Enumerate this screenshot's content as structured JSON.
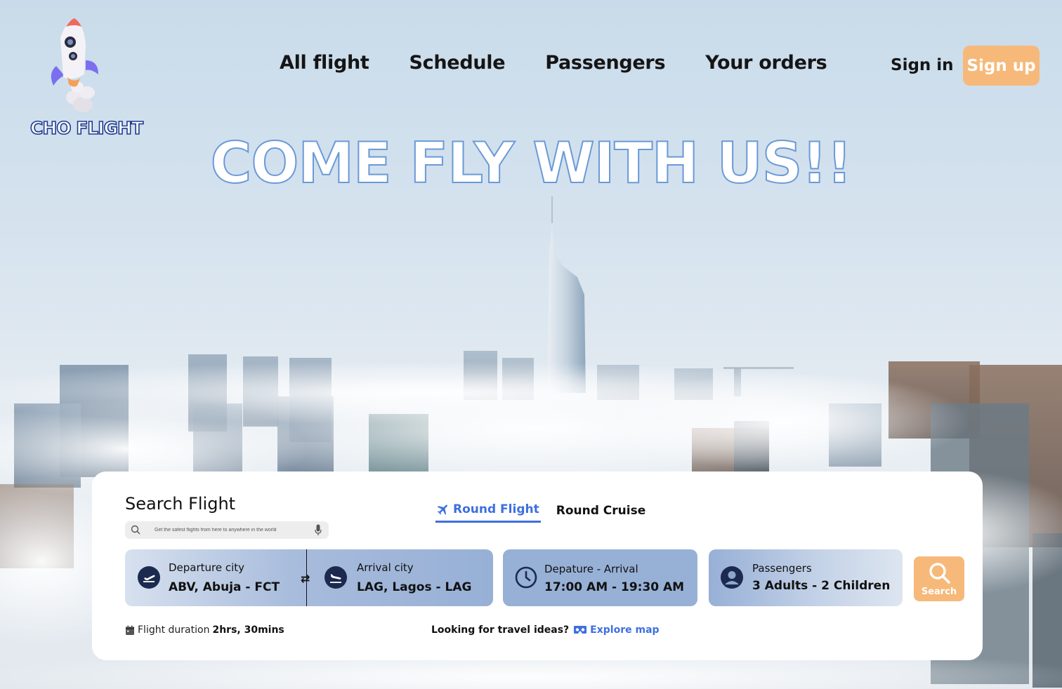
{
  "brand": {
    "name": "CHO FLIGHT"
  },
  "nav": {
    "items": [
      "All flight",
      "Schedule",
      "Passengers",
      "Your orders"
    ],
    "sign_in": "Sign in",
    "sign_up": "Sign up"
  },
  "hero": {
    "title": "COME FLY WITH US!!"
  },
  "search": {
    "title": "Search Flight",
    "placeholder": "Get the safest flights from here to anywhere in the world",
    "tabs": [
      {
        "label": "Round Flight",
        "active": true,
        "icon": "plane-icon"
      },
      {
        "label": "Round Cruise",
        "active": false
      }
    ],
    "departure": {
      "label": "Departure city",
      "value": "ABV, Abuja - FCT",
      "icon": "plane-takeoff-icon"
    },
    "arrival": {
      "label": "Arrival city",
      "value": "LAG, Lagos - LAG",
      "icon": "plane-landing-icon"
    },
    "time": {
      "label": "Depature - Arrival",
      "value": "17:00 AM - 19:30 AM",
      "icon": "clock-icon"
    },
    "passengers": {
      "label": "Passengers",
      "value": "3 Adults - 2 Children",
      "icon": "user-icon"
    },
    "button": "Search",
    "duration_label": "Flight duration",
    "duration_value": "2hrs, 30mins",
    "ideas_text": "Looking for travel ideas?",
    "explore_link": "Explore map"
  },
  "colors": {
    "accent": "#3d6fe0",
    "button": "#f6b97a",
    "field": "#97b0d6",
    "navy": "#1b2a4e"
  }
}
